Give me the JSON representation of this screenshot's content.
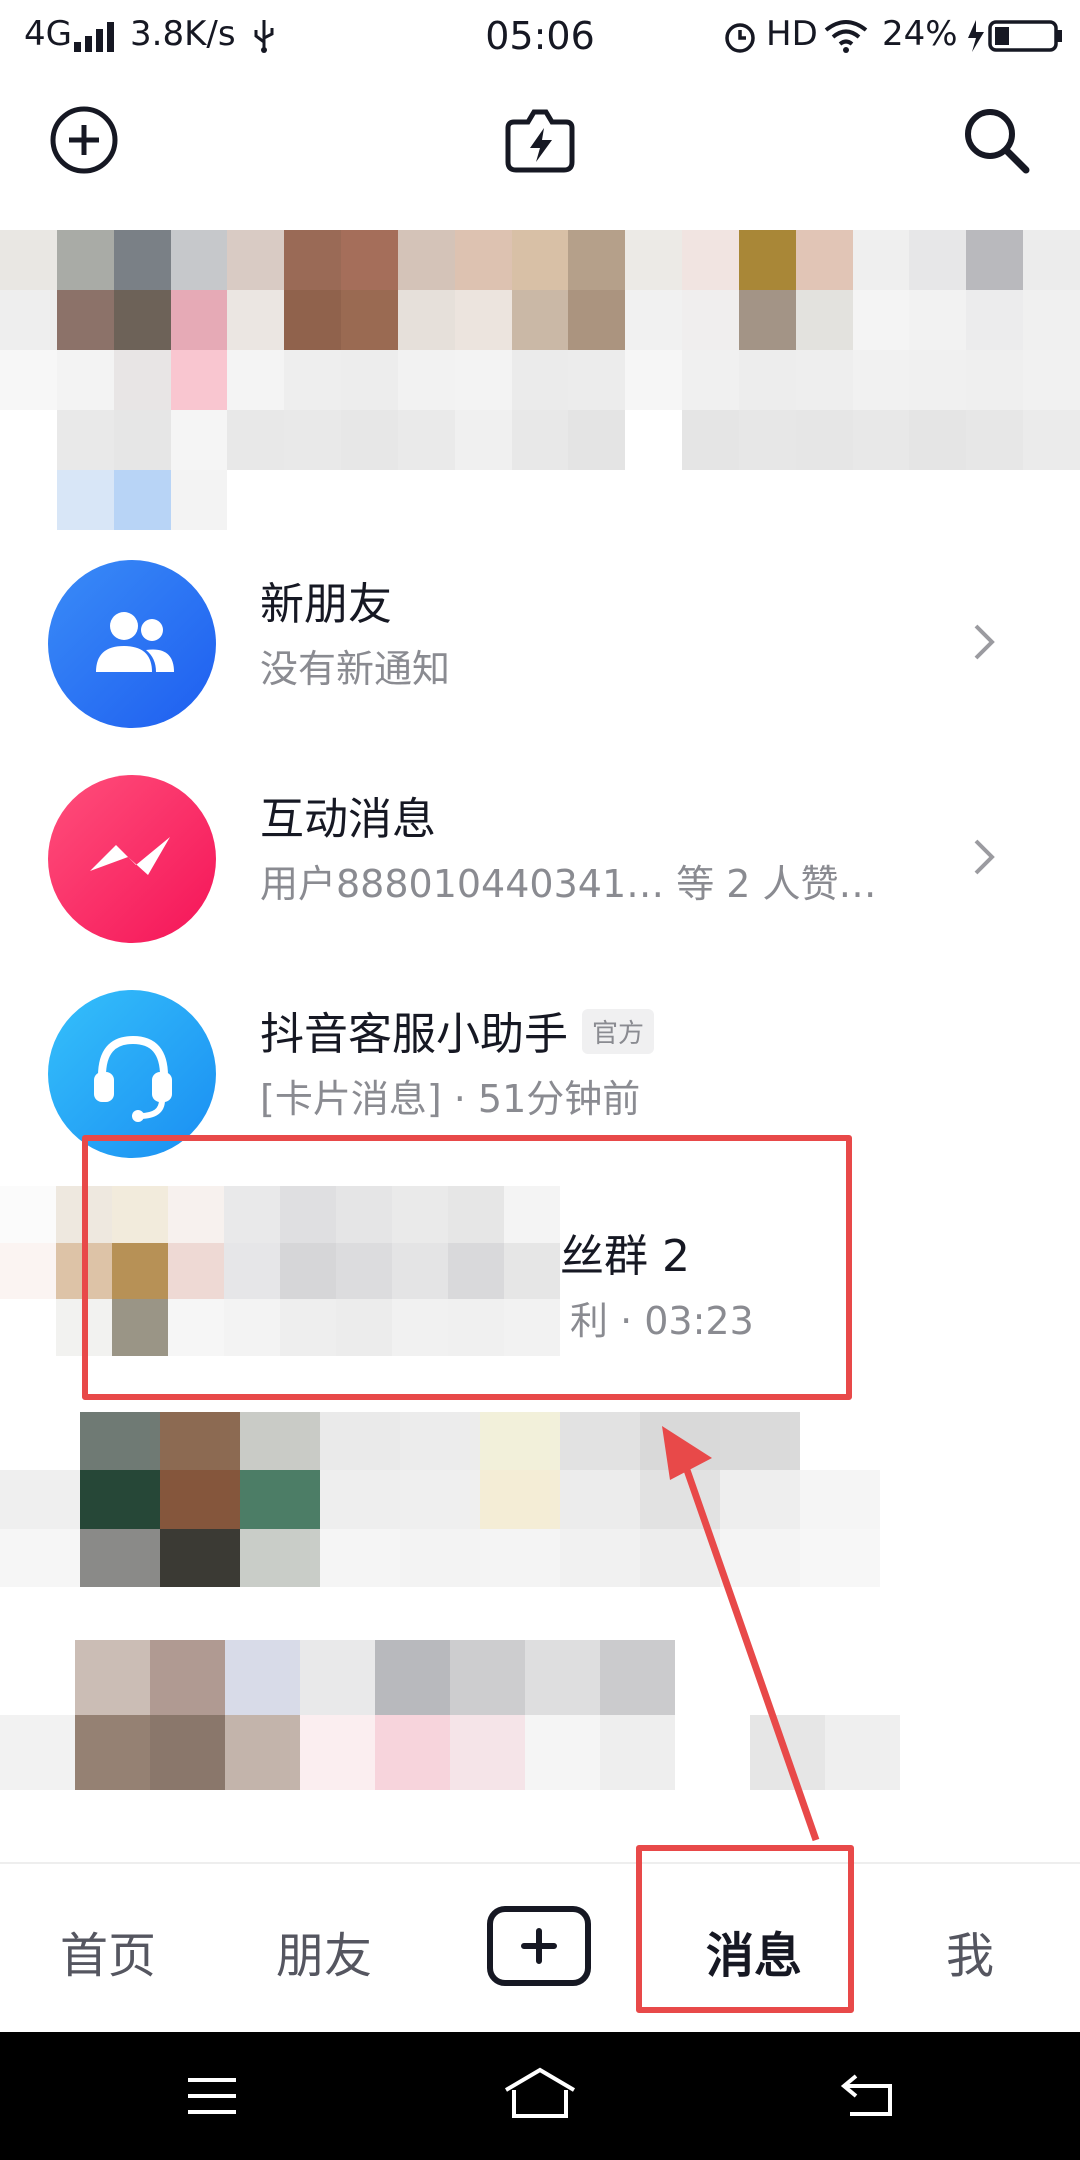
{
  "status_bar": {
    "network": "4G",
    "speed": "3.8K/s",
    "time": "05:06",
    "hd": "HD",
    "battery": "24%"
  },
  "messages": [
    {
      "title": "新朋友",
      "subtitle": "没有新通知",
      "icon": "users-icon",
      "color": "#2f74f5"
    },
    {
      "title": "互动消息",
      "subtitle": "用户888010440341… 等 2 人赞…",
      "icon": "interaction-icon",
      "color": "#fe2c55"
    },
    {
      "title": "抖音客服小助手",
      "badge": "官方",
      "subtitle": "[卡片消息] · 51分钟前",
      "icon": "headset-icon",
      "color": "#22a7f5"
    },
    {
      "title": "丝群 2",
      "subtitle": "利 · 03:23"
    }
  ],
  "bottom_nav": {
    "home": "首页",
    "friends": "朋友",
    "messages": "消息",
    "me": "我"
  },
  "colors": {
    "annotation": "#e84949"
  }
}
